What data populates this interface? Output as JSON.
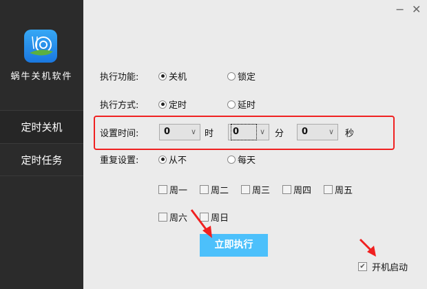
{
  "app": {
    "name": "蜗牛关机软件",
    "logo_icon": "snail-logo-icon"
  },
  "window": {
    "minimize": "−",
    "close": "✕"
  },
  "sidebar": {
    "items": [
      {
        "label": "定时关机",
        "active": true
      },
      {
        "label": "定时任务",
        "active": false
      }
    ]
  },
  "form": {
    "function": {
      "label": "执行功能:",
      "options": [
        "关机",
        "锁定"
      ],
      "selected": "关机"
    },
    "mode": {
      "label": "执行方式:",
      "options": [
        "定时",
        "延时"
      ],
      "selected": "定时"
    },
    "time": {
      "label": "设置时间:",
      "hour": "0",
      "hour_unit": "时",
      "minute": "0",
      "minute_unit": "分",
      "second": "0",
      "second_unit": "秒"
    },
    "repeat": {
      "label": "重复设置:",
      "options": [
        "从不",
        "每天"
      ],
      "selected": "从不"
    },
    "days": [
      "周一",
      "周二",
      "周三",
      "周四",
      "周五",
      "周六",
      "周日"
    ]
  },
  "run_button": "立即执行",
  "autostart": {
    "label": "开机启动",
    "checked": true
  },
  "colors": {
    "sidebar": "#2b2b2b",
    "accent": "#4cc0fb",
    "highlight": "#f02020"
  }
}
